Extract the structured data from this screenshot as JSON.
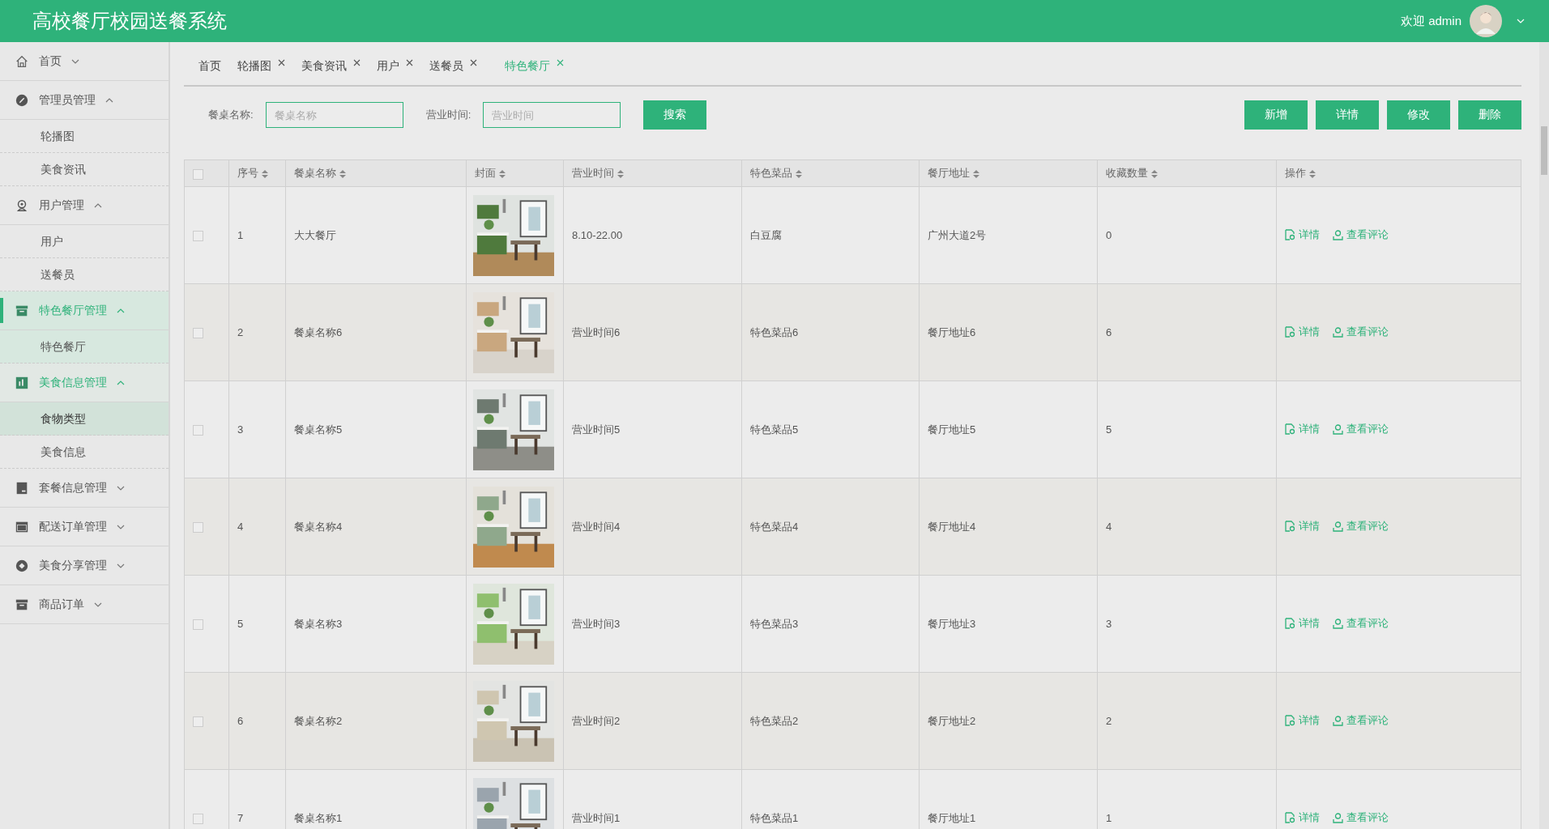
{
  "header": {
    "title": "高校餐厅校园送餐系统",
    "welcome": "欢迎 admin"
  },
  "sidebar": {
    "items": [
      {
        "label": "首页",
        "expanded": false,
        "selected": false,
        "highlighted": false
      },
      {
        "label": "管理员管理",
        "expanded": true,
        "selected": false,
        "highlighted": false,
        "children": [
          {
            "label": "轮播图",
            "selected": false,
            "highlighted": false
          },
          {
            "label": "美食资讯",
            "selected": false,
            "highlighted": false
          }
        ]
      },
      {
        "label": "用户管理",
        "expanded": true,
        "selected": false,
        "highlighted": false,
        "children": [
          {
            "label": "用户",
            "selected": false,
            "highlighted": false
          },
          {
            "label": "送餐员",
            "selected": false,
            "highlighted": false
          }
        ]
      },
      {
        "label": "特色餐厅管理",
        "expanded": true,
        "selected": true,
        "highlighted": false,
        "children": [
          {
            "label": "特色餐厅",
            "selected": true,
            "highlighted": false
          }
        ]
      },
      {
        "label": "美食信息管理",
        "expanded": true,
        "selected": false,
        "highlighted": true,
        "children": [
          {
            "label": "食物类型",
            "selected": false,
            "highlighted": true
          },
          {
            "label": "美食信息",
            "selected": false,
            "highlighted": false
          }
        ]
      },
      {
        "label": "套餐信息管理",
        "expanded": false,
        "selected": false,
        "highlighted": false
      },
      {
        "label": "配送订单管理",
        "expanded": false,
        "selected": false,
        "highlighted": false
      },
      {
        "label": "美食分享管理",
        "expanded": false,
        "selected": false,
        "highlighted": false
      },
      {
        "label": "商品订单",
        "expanded": false,
        "selected": false,
        "highlighted": false
      }
    ]
  },
  "tabs": [
    {
      "label": "首页",
      "selected": false,
      "closable": false
    },
    {
      "label": "轮播图",
      "selected": false,
      "closable": true
    },
    {
      "label": "美食资讯",
      "selected": false,
      "closable": true
    },
    {
      "label": "用户",
      "selected": false,
      "closable": true
    },
    {
      "label": "送餐员",
      "selected": false,
      "closable": true
    },
    {
      "label": "特色餐厅",
      "selected": true,
      "closable": true
    }
  ],
  "search": {
    "fields": [
      {
        "label": "餐桌名称:",
        "placeholder": "餐桌名称"
      },
      {
        "label": "营业时间:",
        "placeholder": "营业时间"
      }
    ],
    "button": "搜索"
  },
  "actions": [
    "新增",
    "详情",
    "修改",
    "删除"
  ],
  "table": {
    "all_checked": false,
    "columns": [
      "序号",
      "餐桌名称",
      "封面",
      "营业时间",
      "特色菜品",
      "餐厅地址",
      "收藏数量",
      "操作"
    ],
    "rows": [
      {
        "checked": false,
        "cells": [
          "1",
          "大大餐厅",
          "",
          "8.10-22.00",
          "白豆腐",
          "广州大道2号",
          "0"
        ],
        "actions": [
          "详情",
          "查看评论"
        ]
      },
      {
        "checked": false,
        "cells": [
          "2",
          "餐桌名称6",
          "",
          "营业时间6",
          "特色菜品6",
          "餐厅地址6",
          "6"
        ],
        "actions": [
          "详情",
          "查看评论"
        ]
      },
      {
        "checked": false,
        "cells": [
          "3",
          "餐桌名称5",
          "",
          "营业时间5",
          "特色菜品5",
          "餐厅地址5",
          "5"
        ],
        "actions": [
          "详情",
          "查看评论"
        ]
      },
      {
        "checked": false,
        "cells": [
          "4",
          "餐桌名称4",
          "",
          "营业时间4",
          "特色菜品4",
          "餐厅地址4",
          "4"
        ],
        "actions": [
          "详情",
          "查看评论"
        ]
      },
      {
        "checked": false,
        "cells": [
          "5",
          "餐桌名称3",
          "",
          "营业时间3",
          "特色菜品3",
          "餐厅地址3",
          "3"
        ],
        "actions": [
          "详情",
          "查看评论"
        ]
      },
      {
        "checked": false,
        "cells": [
          "6",
          "餐桌名称2",
          "",
          "营业时间2",
          "特色菜品2",
          "餐厅地址2",
          "2"
        ],
        "actions": [
          "详情",
          "查看评论"
        ]
      },
      {
        "checked": false,
        "cells": [
          "7",
          "餐桌名称1",
          "",
          "营业时间1",
          "特色菜品1",
          "餐厅地址1",
          "1"
        ],
        "actions": [
          "详情",
          "查看评论"
        ]
      }
    ]
  }
}
